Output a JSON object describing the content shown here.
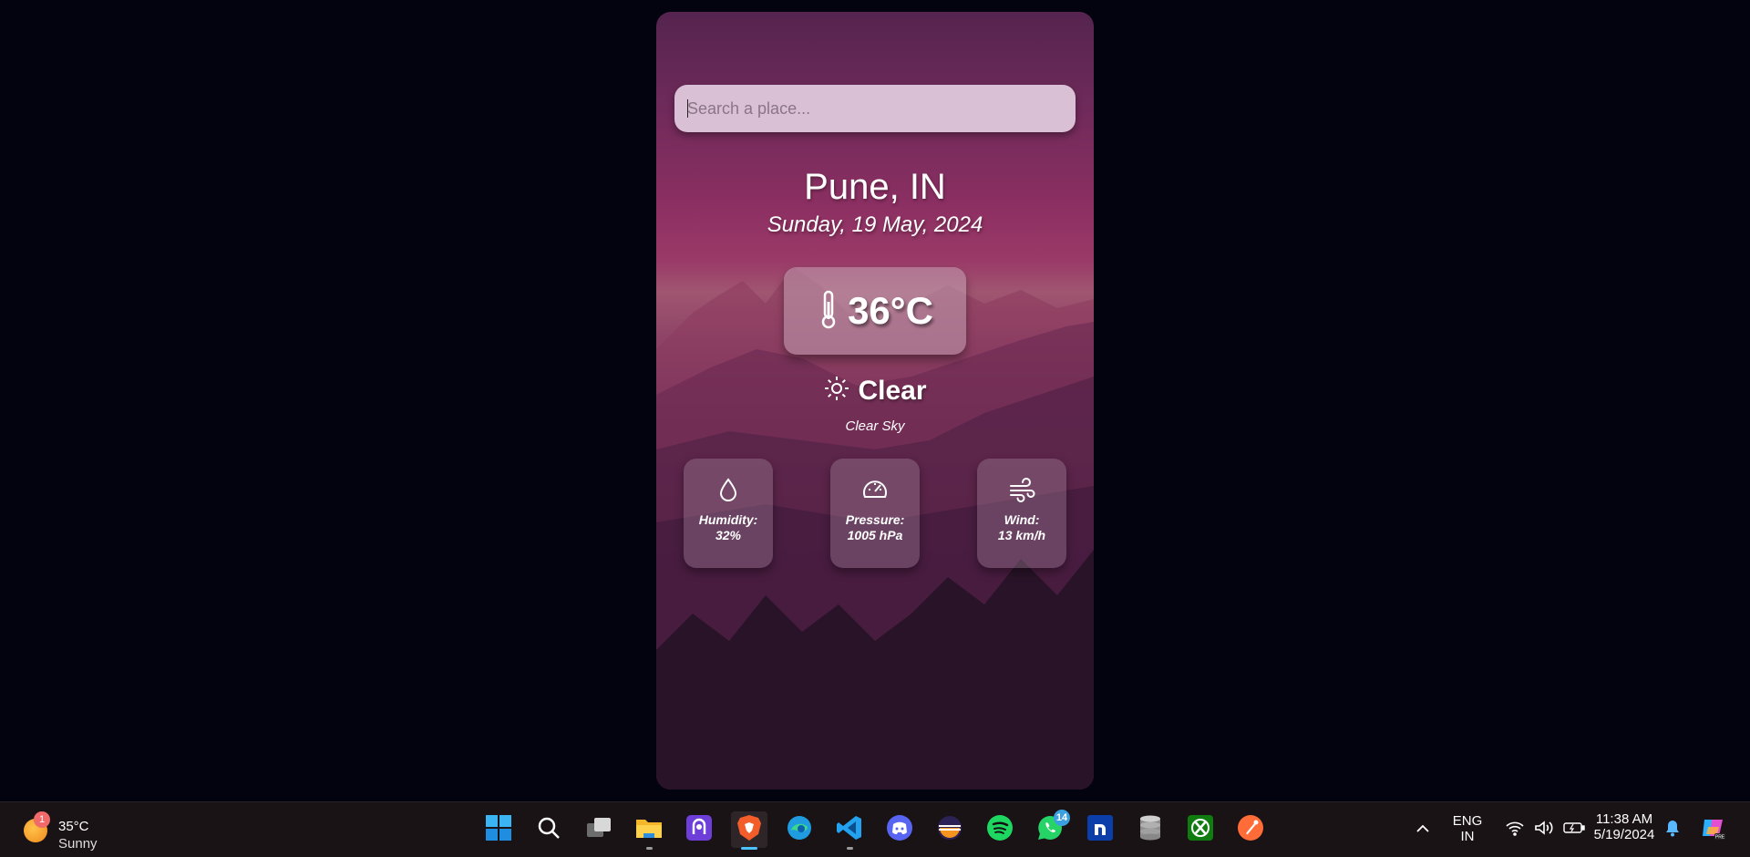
{
  "search": {
    "placeholder": "Search a place..."
  },
  "location": {
    "city": "Pune, IN",
    "date": "Sunday, 19 May, 2024"
  },
  "current": {
    "temperature": "36°C",
    "condition": "Clear",
    "description": "Clear Sky",
    "icons": {
      "temperature": "thermometer-icon",
      "condition": "sun-icon"
    }
  },
  "stats": {
    "humidity": {
      "label": "Humidity:",
      "value": "32%",
      "icon": "droplet-icon"
    },
    "pressure": {
      "label": "Pressure:",
      "value": "1005 hPa",
      "icon": "gauge-icon"
    },
    "wind": {
      "label": "Wind:",
      "value": "13 km/h",
      "icon": "wind-icon"
    }
  },
  "taskbar": {
    "weather_widget": {
      "badge": "1",
      "temp": "35°C",
      "condition": "Sunny"
    },
    "apps": [
      {
        "name": "start-icon"
      },
      {
        "name": "search-icon"
      },
      {
        "name": "task-view-icon"
      },
      {
        "name": "file-explorer-icon"
      },
      {
        "name": "proton-vpn-icon"
      },
      {
        "name": "brave-browser-icon"
      },
      {
        "name": "edge-browser-icon"
      },
      {
        "name": "vscode-icon"
      },
      {
        "name": "discord-icon"
      },
      {
        "name": "eclipse-icon"
      },
      {
        "name": "spotify-icon"
      },
      {
        "name": "whatsapp-icon",
        "badge": "14"
      },
      {
        "name": "notion-icon"
      },
      {
        "name": "database-icon"
      },
      {
        "name": "xbox-icon"
      },
      {
        "name": "postman-icon"
      }
    ],
    "tray": {
      "language": "ENG",
      "region": "IN",
      "time": "11:38 AM",
      "date": "5/19/2024"
    }
  },
  "colors": {
    "background": "#03020f",
    "taskbar": "#1a1316",
    "accent": "#4cc2ff"
  }
}
